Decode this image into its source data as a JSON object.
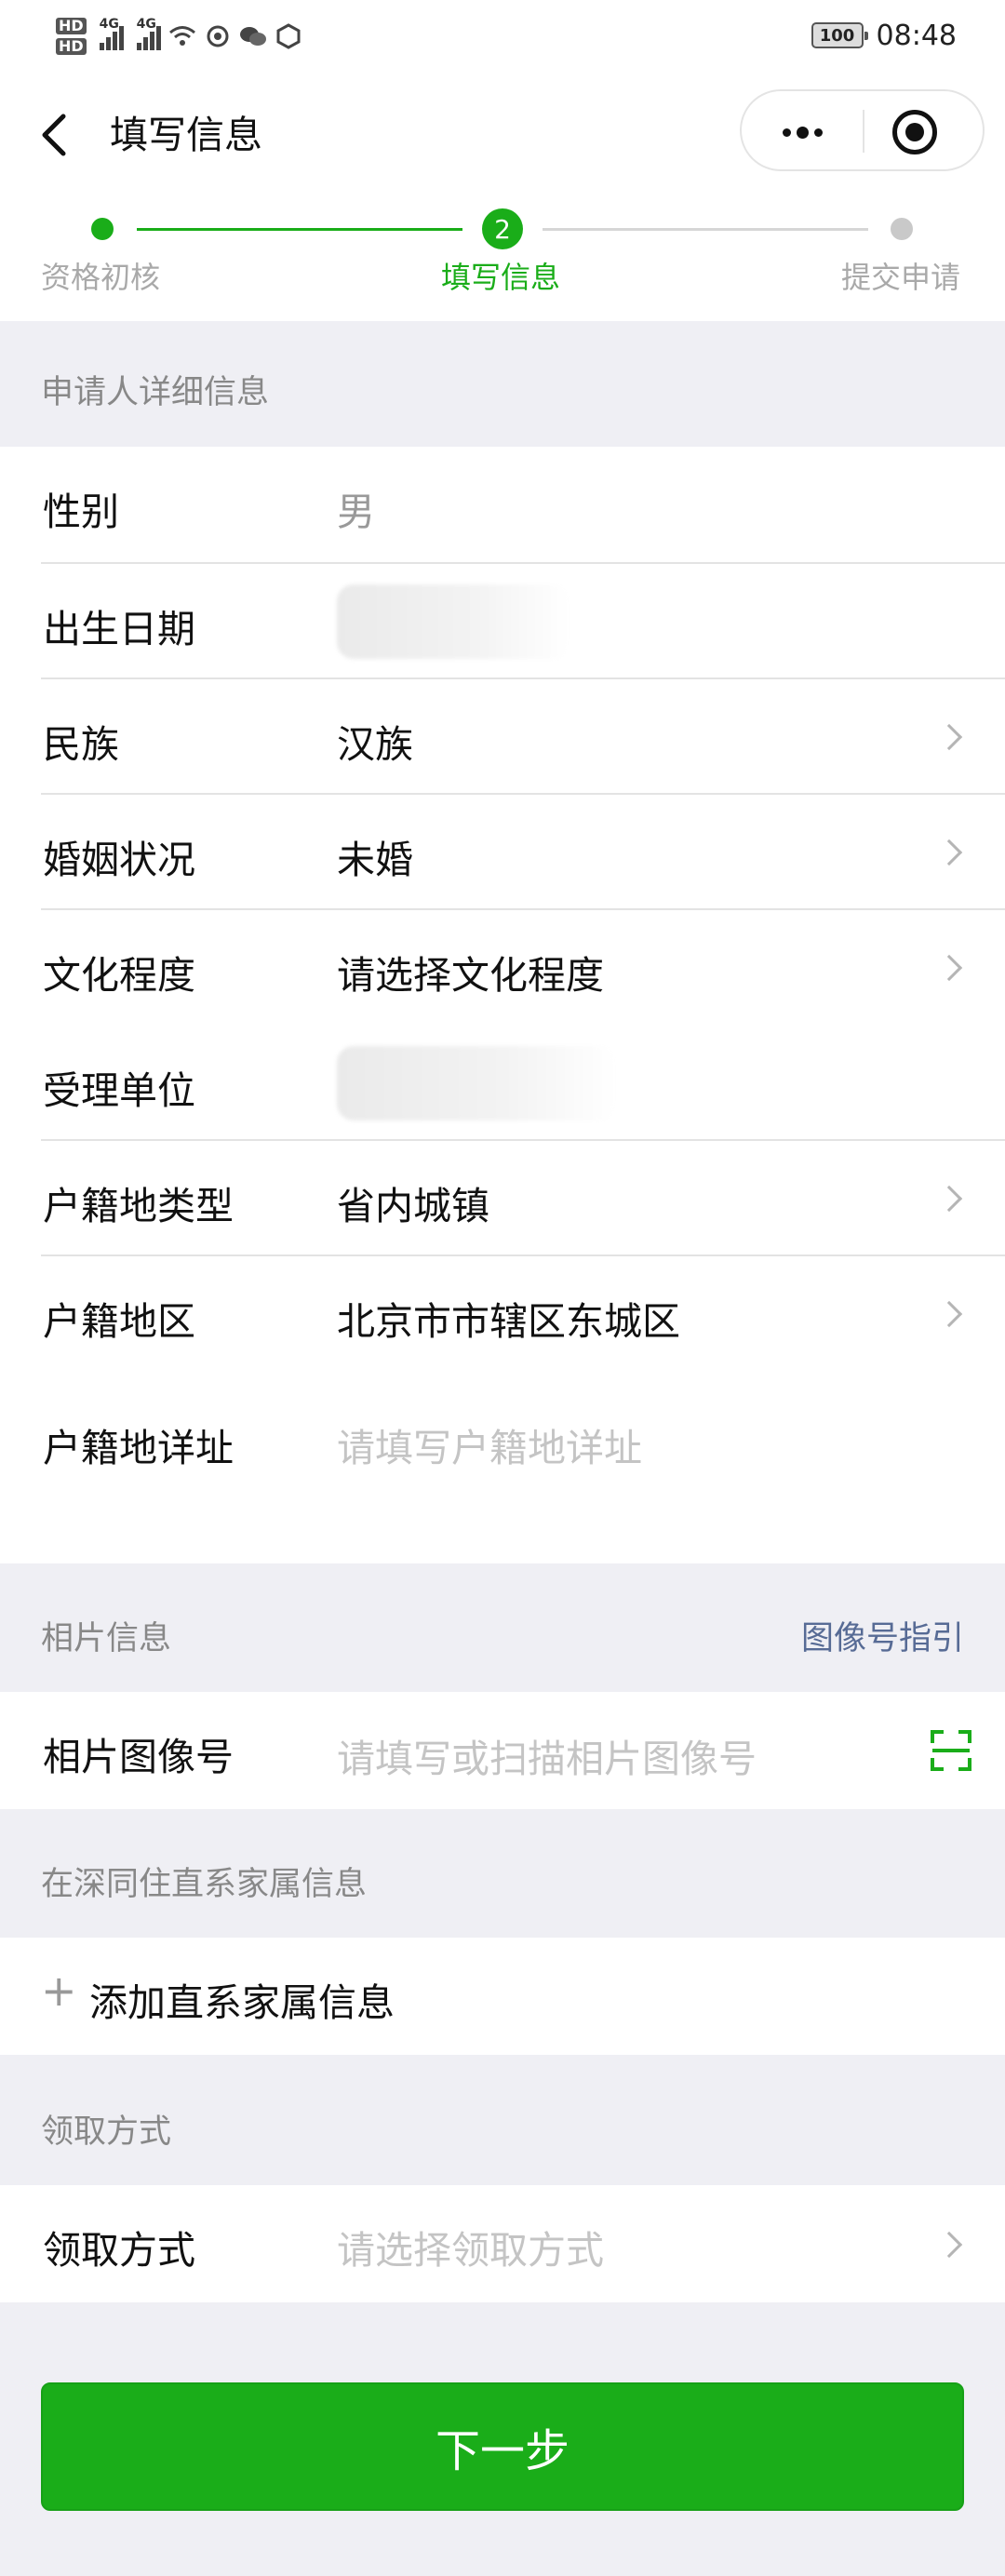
{
  "status_bar": {
    "hd1": "HD",
    "hd2": "HD",
    "net1": "4G",
    "net2": "4G",
    "battery": "100",
    "time": "08:48"
  },
  "nav": {
    "title": "填写信息"
  },
  "steps": [
    {
      "label": "资格初核",
      "state": "done"
    },
    {
      "label": "填写信息",
      "state": "current",
      "number": "2"
    },
    {
      "label": "提交申请",
      "state": "todo"
    }
  ],
  "applicant": {
    "header": "申请人详细信息",
    "rows": [
      {
        "label": "性别",
        "value": "男"
      },
      {
        "label": "出生日期",
        "value": ""
      },
      {
        "label": "民族",
        "value": "汉族"
      },
      {
        "label": "婚姻状况",
        "value": "未婚"
      },
      {
        "label": "文化程度",
        "value": "请选择文化程度"
      },
      {
        "label": "受理单位",
        "value": ""
      },
      {
        "label": "户籍地类型",
        "value": "省内城镇"
      },
      {
        "label": "户籍地区",
        "value": "北京市市辖区东城区"
      },
      {
        "label": "户籍地详址",
        "placeholder": "请填写户籍地详址"
      }
    ]
  },
  "photo": {
    "header": "相片信息",
    "guide_link": "图像号指引",
    "label": "相片图像号",
    "placeholder": "请填写或扫描相片图像号"
  },
  "family": {
    "header": "在深同住直系家属信息",
    "add_plus": "+",
    "add_label": "添加直系家属信息"
  },
  "pickup": {
    "header": "领取方式",
    "label": "领取方式",
    "placeholder": "请选择领取方式"
  },
  "next_button": "下一步",
  "colors": {
    "accent": "#1aad19",
    "link": "#576b95",
    "background": "#efeff4"
  }
}
